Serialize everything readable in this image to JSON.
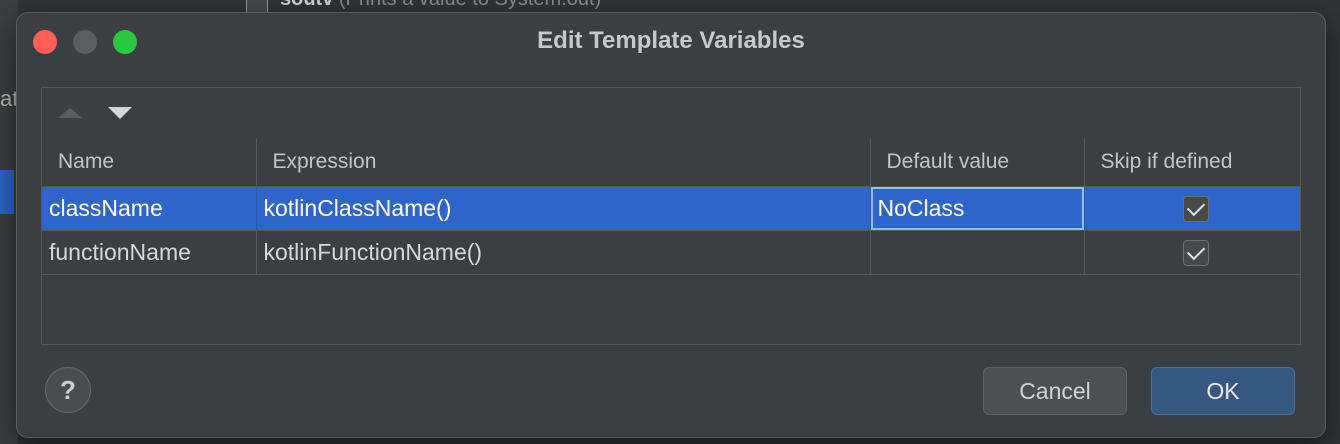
{
  "background": {
    "edge_text": "at",
    "top_line_bold": "soutv",
    "top_line_rest": " (Prints a value to System.out)"
  },
  "dialog": {
    "title": "Edit Template Variables"
  },
  "toolbar": {
    "move_up_icon": "triangle-up-icon",
    "move_down_icon": "triangle-down-icon"
  },
  "table": {
    "columns": [
      "Name",
      "Expression",
      "Default value",
      "Skip if defined"
    ],
    "rows": [
      {
        "name": "className",
        "expression": "kotlinClassName()",
        "default_value": "NoClass",
        "skip_if_defined": true,
        "selected": true
      },
      {
        "name": "functionName",
        "expression": "kotlinFunctionName()",
        "default_value": "",
        "skip_if_defined": true,
        "selected": false
      }
    ]
  },
  "footer": {
    "help_label": "?",
    "cancel_label": "Cancel",
    "ok_label": "OK"
  },
  "colors": {
    "selection": "#2f65ca",
    "ok_button": "#365880",
    "close": "#fe5f57",
    "maximize": "#28c840"
  }
}
